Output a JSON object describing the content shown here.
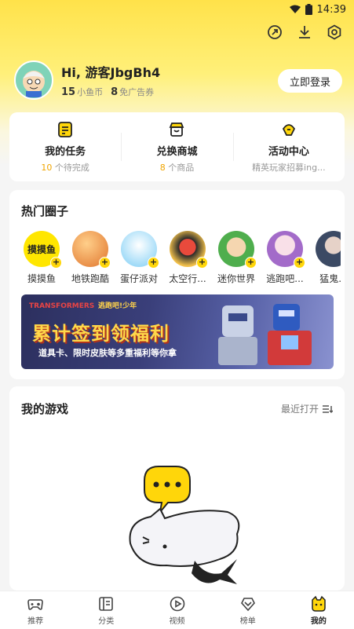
{
  "status_bar": {
    "time": "14:39"
  },
  "profile": {
    "greeting": "Hi, 游客JbgBh4",
    "coins_value": "15",
    "coins_label": "小鱼币",
    "ad_coupons_value": "8",
    "ad_coupons_label": "免广告券",
    "login_label": "立即登录"
  },
  "quick_links": [
    {
      "title": "我的任务",
      "sub_num": "10",
      "sub_text": " 个待完成"
    },
    {
      "title": "兑换商城",
      "sub_num": "8",
      "sub_text": " 个商品"
    },
    {
      "title": "活动中心",
      "sub_num": "",
      "sub_text": "精英玩家招募ing..."
    }
  ],
  "hot_circles": {
    "title": "热门圈子",
    "items": [
      {
        "label": "摸摸鱼",
        "logo_text": "摸摸鱼",
        "color": "#ffe600"
      },
      {
        "label": "地铁跑酷",
        "logo_text": "",
        "color": "#f3a65a"
      },
      {
        "label": "蛋仔派对",
        "logo_text": "",
        "color": "#8ad7ff"
      },
      {
        "label": "太空行...",
        "logo_text": "",
        "color": "#3a3a3a"
      },
      {
        "label": "迷你世界",
        "logo_text": "",
        "color": "#6cc46a"
      },
      {
        "label": "逃跑吧...",
        "logo_text": "",
        "color": "#b784d6"
      },
      {
        "label": "猛鬼...",
        "logo_text": "",
        "color": "#5b6b86"
      }
    ],
    "banner": {
      "brand": "TRANSFORMERS",
      "logo": "逃跑吧!少年",
      "title": "累计签到领福利",
      "subtitle": "道具卡、限时皮肤等多重福利等你拿"
    }
  },
  "my_games": {
    "title": "我的游戏",
    "recent_label": "最近打开"
  },
  "tabbar": [
    {
      "label": "推荐",
      "icon": "gamepad-icon"
    },
    {
      "label": "分类",
      "icon": "category-icon"
    },
    {
      "label": "视频",
      "icon": "play-icon"
    },
    {
      "label": "榜单",
      "icon": "ranking-icon"
    },
    {
      "label": "我的",
      "icon": "profile-icon"
    }
  ]
}
